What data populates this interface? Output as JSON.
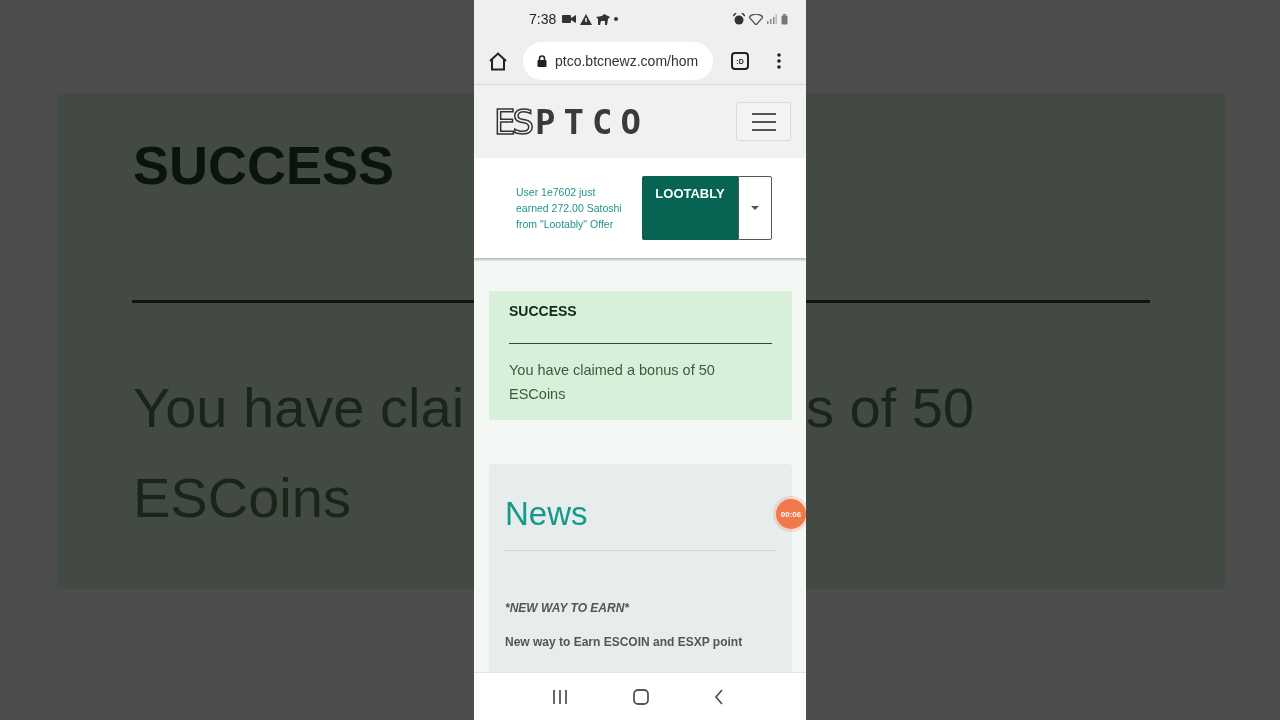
{
  "backdrop": {
    "title": "SUCCESS",
    "message_left": "You have clai",
    "message_right": "s of 50",
    "message_line_2": "ESCoins"
  },
  "status_bar": {
    "time": "7:38"
  },
  "browser": {
    "url": "ptco.btcnewz.com/hom",
    "tab_badge": ":D"
  },
  "site": {
    "logo_mark": "ES",
    "logo_text": "PTCO"
  },
  "ticker": {
    "text": "User 1e7602 just earned 272.00 Satoshi from \"Lootably\" Offer",
    "button": "LOOTABLY"
  },
  "alert": {
    "title": "SUCCESS",
    "message": "You have claimed a bonus of 50 ESCoins"
  },
  "news": {
    "title": "News",
    "items": [
      {
        "kind": "heading",
        "text": "*NEW WAY TO EARN*"
      },
      {
        "kind": "body",
        "text": "New way to Earn ESCOIN and ESXP point"
      }
    ]
  },
  "recording_badge": {
    "time": "00:06"
  }
}
